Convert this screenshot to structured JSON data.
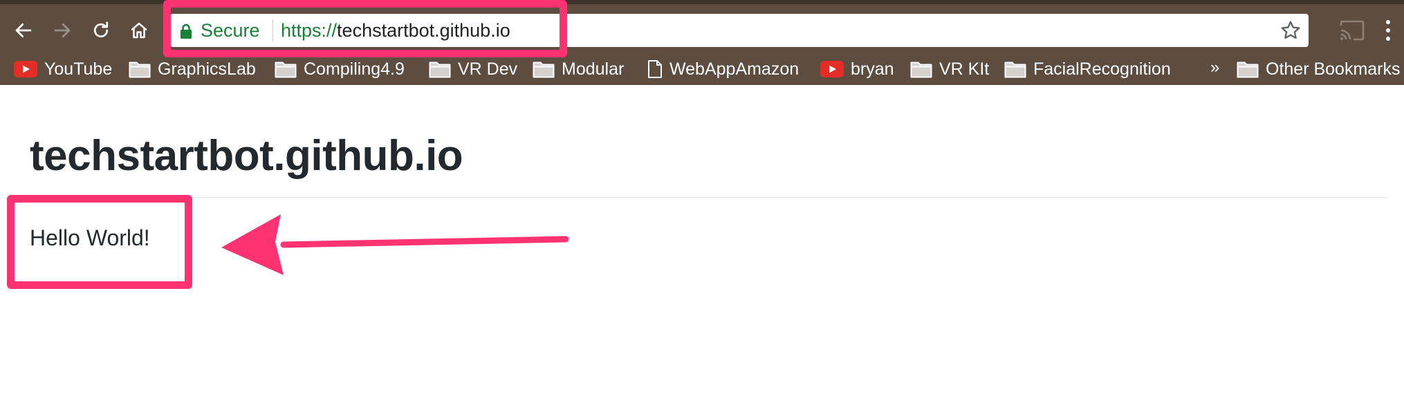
{
  "browser": {
    "secure_label": "Secure",
    "url_scheme": "https://",
    "url_host": "techstartbot.github.io"
  },
  "bookmarks": [
    {
      "label": "YouTube",
      "icon": "youtube-icon"
    },
    {
      "label": "GraphicsLab",
      "icon": "folder-icon"
    },
    {
      "label": "Compiling4.9",
      "icon": "folder-icon"
    },
    {
      "label": "VR Dev",
      "icon": "folder-icon"
    },
    {
      "label": "Modular",
      "icon": "folder-icon"
    },
    {
      "label": "WebAppAmazon",
      "icon": "page-icon"
    },
    {
      "label": "bryan",
      "icon": "youtube-icon"
    },
    {
      "label": "VR KIt",
      "icon": "folder-icon"
    },
    {
      "label": "FacialRecognition",
      "icon": "folder-icon"
    }
  ],
  "bookmarks_overflow": "»",
  "other_bookmarks": "Other Bookmarks",
  "page": {
    "title": "techstartbot.github.io",
    "body_text": "Hello World!"
  },
  "colors": {
    "toolbar": "#5d4d41",
    "secure_green": "#188038",
    "annotation_pink": "#ff3371"
  }
}
